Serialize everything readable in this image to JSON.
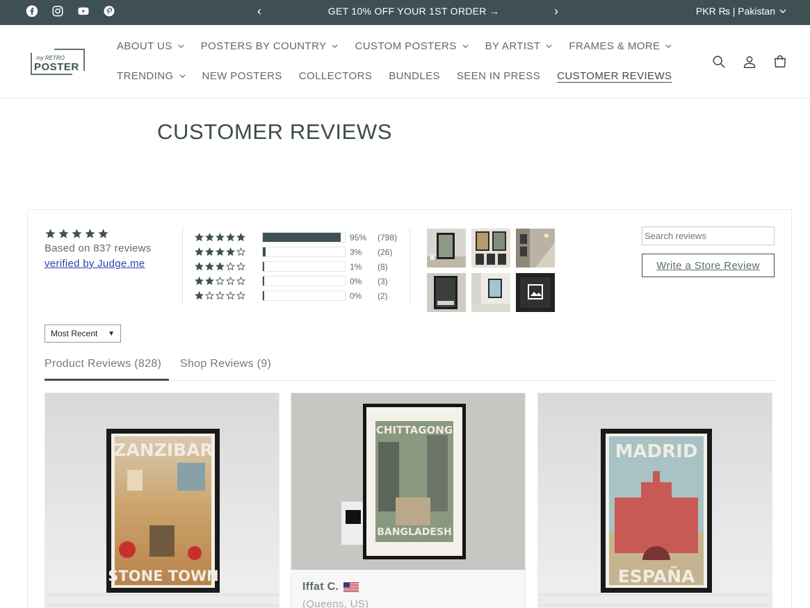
{
  "announcement": {
    "promo_text": "GET 10% OFF YOUR 1ST ORDER",
    "promo_arrow": "→",
    "prev_glyph": "‹",
    "next_glyph": "›",
    "currency": "PKR ₨ | Pakistan",
    "social_icons": [
      "facebook-icon",
      "instagram-icon",
      "youtube-icon",
      "pinterest-icon"
    ]
  },
  "header": {
    "logo_text_top": "my RETRO",
    "logo_text_bottom": "POSTER",
    "nav_row1": [
      {
        "label": "ABOUT US",
        "dropdown": true
      },
      {
        "label": "POSTERS BY COUNTRY",
        "dropdown": true
      },
      {
        "label": "CUSTOM POSTERS",
        "dropdown": true
      },
      {
        "label": "BY ARTIST",
        "dropdown": true
      },
      {
        "label": "FRAMES & MORE",
        "dropdown": true
      }
    ],
    "nav_row2": [
      {
        "label": "TRENDING",
        "dropdown": true
      },
      {
        "label": "NEW POSTERS",
        "dropdown": false
      },
      {
        "label": "COLLECTORS",
        "dropdown": false
      },
      {
        "label": "BUNDLES",
        "dropdown": false
      },
      {
        "label": "SEEN IN PRESS",
        "dropdown": false
      },
      {
        "label": "CUSTOMER REVIEWS",
        "dropdown": false,
        "active": true
      }
    ],
    "icons": [
      "search-icon",
      "account-icon",
      "cart-icon"
    ]
  },
  "page": {
    "title": "CUSTOMER REVIEWS"
  },
  "reviews_widget": {
    "average_rating": 5,
    "based_on": "Based on 837 reviews",
    "verified_text": "verified by Judge.me",
    "histogram": [
      {
        "stars": 5,
        "pct_label": "95%",
        "count_label": "(798)",
        "fraction": 0.95
      },
      {
        "stars": 4,
        "pct_label": "3%",
        "count_label": "(26)",
        "fraction": 0.03
      },
      {
        "stars": 3,
        "pct_label": "1%",
        "count_label": "(8)",
        "fraction": 0.01
      },
      {
        "stars": 2,
        "pct_label": "0%",
        "count_label": "(3)",
        "fraction": 0.0
      },
      {
        "stars": 1,
        "pct_label": "0%",
        "count_label": "(2)",
        "fraction": 0.0
      }
    ],
    "search_placeholder": "Search reviews",
    "write_review_label": "Write a Store Review",
    "sort_value": "Most Recent",
    "sort_arrow": "▼",
    "tabs": [
      {
        "label": "Product Reviews (828)",
        "active": true
      },
      {
        "label": "Shop Reviews (9)",
        "active": false
      }
    ],
    "cards": [
      {
        "poster_top": "ZANZIBAR",
        "poster_bottom": "STONE TOWN"
      },
      {
        "poster_top": "CHITTAGONG",
        "poster_bottom": "BANGLADESH",
        "reviewer": "Iffat C.",
        "location": "(Queens, US)"
      },
      {
        "poster_top": "MADRID",
        "poster_bottom": "ESPAÑA"
      }
    ]
  },
  "colors": {
    "brand_dark": "#3f5055",
    "link_blue": "#2a3fb0",
    "text": "#3c4a4e"
  }
}
